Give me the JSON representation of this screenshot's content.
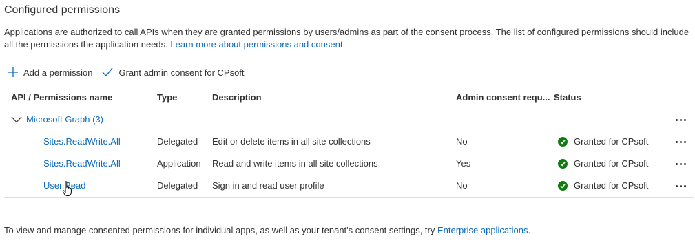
{
  "title": "Configured permissions",
  "description": {
    "text": "Applications are authorized to call APIs when they are granted permissions by users/admins as part of the consent process. The list of configured permissions should include all the permissions the application needs.",
    "link": "Learn more about permissions and consent"
  },
  "toolbar": {
    "add_label": "Add a permission",
    "add_icon": "plus-icon",
    "grant_label": "Grant admin consent for CPsoft",
    "grant_icon": "checkmark-icon"
  },
  "table": {
    "headers": {
      "name": "API / Permissions name",
      "type": "Type",
      "description": "Description",
      "admin": "Admin consent requ...",
      "status": "Status"
    },
    "group": {
      "label": "Microsoft Graph (3)",
      "icon": "chevron-down-icon"
    },
    "rows": [
      {
        "name": "Sites.ReadWrite.All",
        "type": "Delegated",
        "description": "Edit or delete items in all site collections",
        "admin": "No",
        "status": "Granted for CPsoft"
      },
      {
        "name": "Sites.ReadWrite.All",
        "type": "Application",
        "description": "Read and write items in all site collections",
        "admin": "Yes",
        "status": "Granted for CPsoft"
      },
      {
        "name": "User.Read",
        "type": "Delegated",
        "description": "Sign in and read user profile",
        "admin": "No",
        "status": "Granted for CPsoft"
      }
    ],
    "status_color": "#107c10",
    "more_icon": "more-icon"
  },
  "footer": {
    "text": "To view and manage consented permissions for individual apps, as well as your tenant's consent settings, try",
    "link": "Enterprise applications",
    "end": "."
  },
  "colors": {
    "link": "#0f6cbd",
    "text": "#323130",
    "success": "#107c10"
  }
}
